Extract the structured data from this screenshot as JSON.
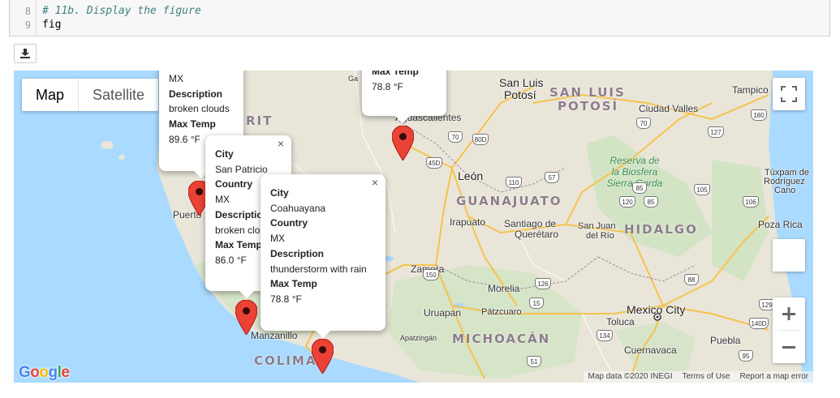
{
  "code": {
    "lines": [
      {
        "num": "8",
        "text": "# 11b. Display the figure"
      },
      {
        "num": "9",
        "text": "fig"
      }
    ]
  },
  "download_button": {
    "icon": "download-icon"
  },
  "map": {
    "type_controls": {
      "map": "Map",
      "satellite": "Satellite"
    },
    "regions": {
      "san_luis_potosi_1": "SAN LUIS",
      "san_luis_potosi_2": "POTOSÍ",
      "guanajuato": "GUANAJUATO",
      "hidalgo": "HIDALGO",
      "michoacan": "MICHOACÁN",
      "colima": "COLIMA",
      "rit": "RIT"
    },
    "cities": {
      "san_luis": "San Luis",
      "potosi": "Potosí",
      "tampico": "Tampico",
      "ciudad_valles": "Ciudad Valles",
      "leon": "León",
      "irapuato": "Irapuato",
      "santiago_de": "Santiago de",
      "queretaro": "Querétaro",
      "san_juan": "San Juan",
      "del_rio": "del Río",
      "zamora": "Zamora",
      "morelia": "Morelia",
      "uruapan": "Uruapan",
      "patzcuaro": "Pátzcuaro",
      "mexico_city": "Mexico City",
      "toluca": "Toluca",
      "cuernavaca": "Cuernavaca",
      "puebla": "Puebla",
      "tuxpam_1": "Túxpam de",
      "tuxpam_2": "Rodríguez",
      "tuxpam_3": "Cano",
      "poza_rica": "Poza Rica",
      "manzanillo": "Manzanillo",
      "puerto": "Puerto",
      "apatzingan": "Apatzingán",
      "aguascalientes": "Aguascalientes",
      "ga": "Ga"
    },
    "park": [
      "Reserva de",
      "la Biosfera",
      "Sierra Gorda"
    ],
    "highways": [
      "70",
      "80D",
      "45D",
      "110",
      "57",
      "120",
      "85",
      "105",
      "106",
      "150",
      "126",
      "88",
      "15",
      "134",
      "51",
      "180",
      "127",
      "70",
      "85",
      "129",
      "140D",
      "95"
    ],
    "google_logo": "Google",
    "attribution": {
      "data": "Map data ©2020 INEGI",
      "terms": "Terms of Use",
      "report": "Report a map error"
    },
    "colors": {
      "water": "#aadaff",
      "land": "#e9e6d9",
      "marker": "#ea4335",
      "hills": "#cde3bf"
    }
  },
  "infowindows": {
    "top_left": {
      "country_value": "MX",
      "description_label": "Description",
      "description_value": "broken clouds",
      "maxtemp_label": "Max Temp",
      "maxtemp_value": "89.6 °F"
    },
    "top_center": {
      "maxtemp_label": "Max Temp",
      "maxtemp_value": "78.8 °F"
    },
    "san_patricio": {
      "city_label": "City",
      "city_value": "San Patricio",
      "country_label": "Country",
      "country_value": "MX",
      "description_label": "Description",
      "description_value": "broken clouds",
      "maxtemp_label": "Max Temp",
      "maxtemp_value": "86.0 °F",
      "close": "×"
    },
    "coahuayana": {
      "city_label": "City",
      "city_value": "Coahuayana",
      "country_label": "Country",
      "country_value": "MX",
      "description_label": "Description",
      "description_value": "thunderstorm with rain",
      "maxtemp_label": "Max Temp",
      "maxtemp_value": "78.8 °F",
      "close": "×"
    }
  }
}
